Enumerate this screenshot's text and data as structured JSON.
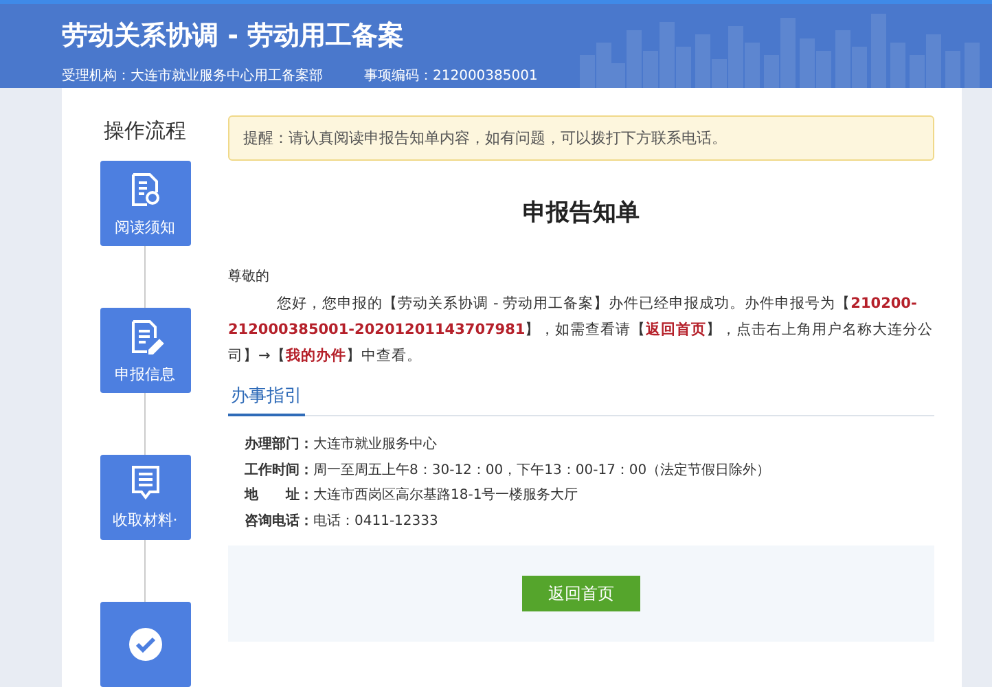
{
  "header": {
    "title": "劳动关系协调 - 劳动用工备案",
    "agency_label": "受理机构：",
    "agency": "大连市就业服务中心用工备案部",
    "code_label": "事项编码：",
    "code": "212000385001"
  },
  "process": {
    "title": "操作流程",
    "steps": [
      {
        "kind": "read",
        "label": "阅读须知"
      },
      {
        "kind": "edit",
        "label": "申报信息"
      },
      {
        "kind": "list",
        "label": "收取材料·"
      },
      {
        "kind": "check"
      }
    ]
  },
  "notice": "提醒：请认真阅读申报告知单内容，如有问题，可以拨打下方联系电话。",
  "document": {
    "title": "申报告知单",
    "greeting": "尊敬的",
    "paragraph": "您好，您申报的【劳动关系协调 - 劳动用工备案】办件已经申报成功。办件申报号为【**210200-212000385001-20201201143707981**】，如需查看请【**返回首页**】，点击右上角用户名称大连分公司】→【**我的办件**】中查看。"
  },
  "guide": {
    "tab": "办事指引",
    "rows": [
      {
        "label": "办理部门：",
        "value": "大连市就业服务中心"
      },
      {
        "label": "工作时间：",
        "value": "周一至周五上午8：30-12：00，下午13：00-17：00（法定节假日除外）"
      },
      {
        "label": "地　　址：",
        "value": "大连市西岗区高尔基路18-1号一楼服务大厅"
      },
      {
        "label": "咨询电话：",
        "value": "电话：0411-12333"
      }
    ]
  },
  "button": "返回首页"
}
